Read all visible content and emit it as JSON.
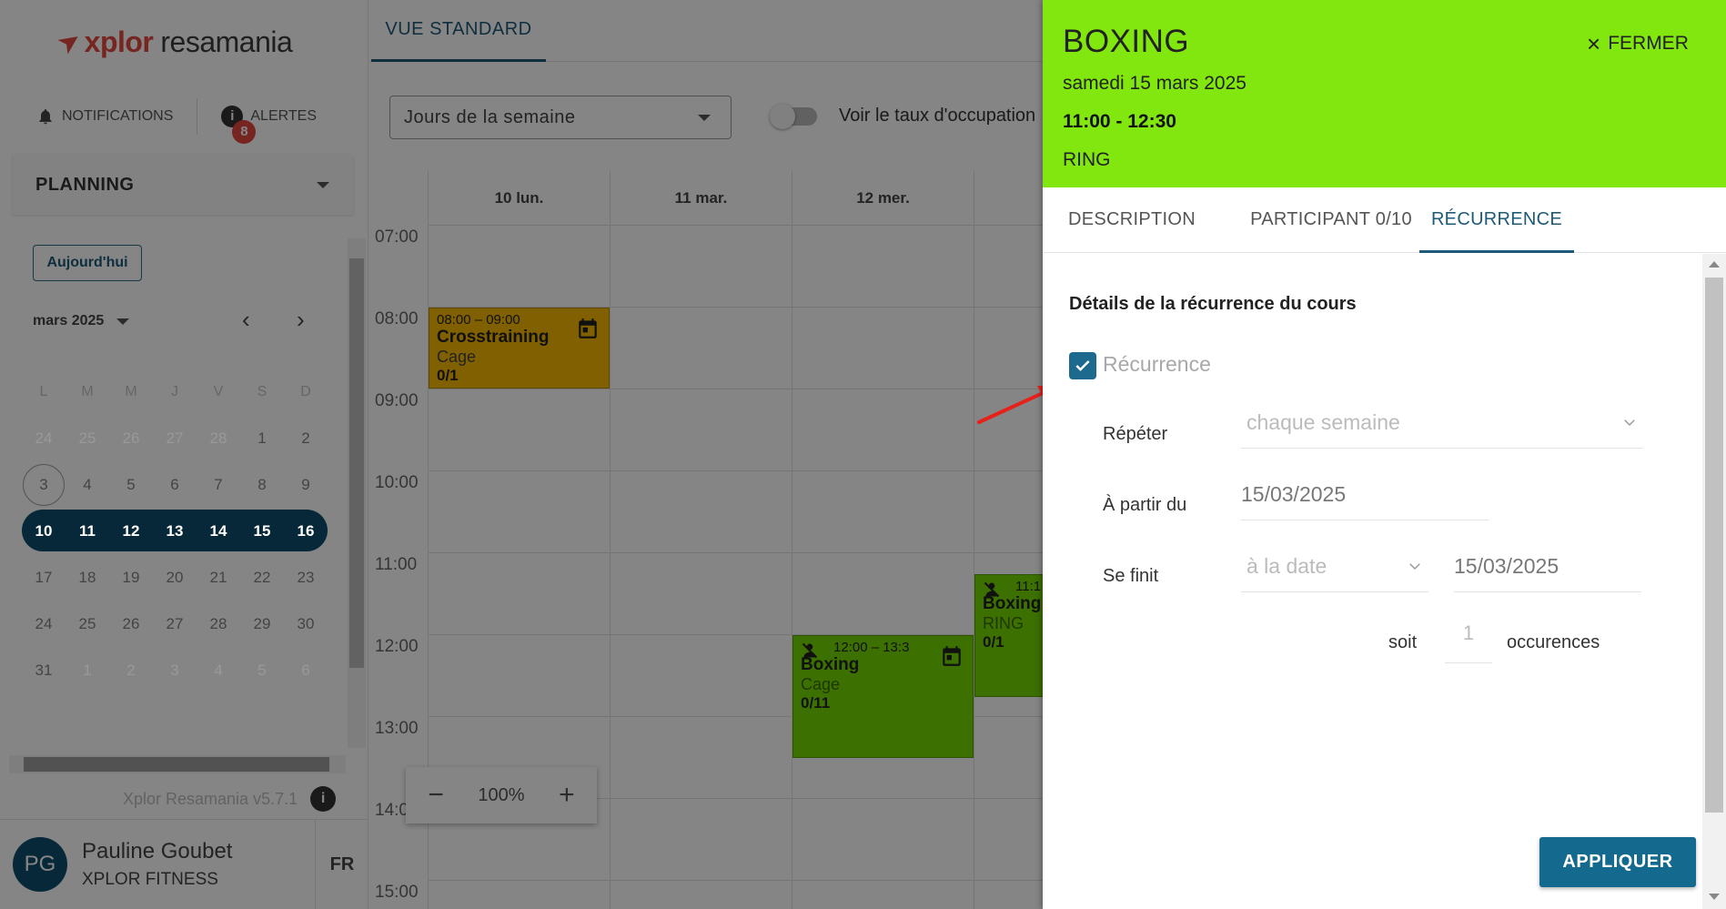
{
  "app": {
    "logo_part1": "xplor",
    "logo_part2": "resamania",
    "version": "Xplor Resamania v5.7.1"
  },
  "sidebar": {
    "notifications_label": "NOTIFICATIONS",
    "alerts_label": "ALERTES",
    "alerts_count": "8",
    "planning_label": "PLANNING",
    "today_button": "Aujourd'hui",
    "month_label": "mars 2025",
    "weekday_headers": [
      "L",
      "M",
      "M",
      "J",
      "V",
      "S",
      "D"
    ],
    "weeks": [
      [
        "24",
        "25",
        "26",
        "27",
        "28",
        "1",
        "2"
      ],
      [
        "3",
        "4",
        "5",
        "6",
        "7",
        "8",
        "9"
      ],
      [
        "10",
        "11",
        "12",
        "13",
        "14",
        "15",
        "16"
      ],
      [
        "17",
        "18",
        "19",
        "20",
        "21",
        "22",
        "23"
      ],
      [
        "24",
        "25",
        "26",
        "27",
        "28",
        "29",
        "30"
      ],
      [
        "31",
        "1",
        "2",
        "3",
        "4",
        "5",
        "6"
      ]
    ]
  },
  "user": {
    "initials": "PG",
    "name": "Pauline Goubet",
    "org": "XPLOR FITNESS",
    "language": "FR"
  },
  "main": {
    "tab_label": "VUE STANDARD",
    "filter_value": "Jours de la semaine",
    "toggle_label": "Voir le taux d'occupation",
    "days": [
      "10 lun.",
      "11 mar.",
      "12 mer."
    ],
    "hours": [
      "07:00",
      "08:00",
      "09:00",
      "10:00",
      "11:00",
      "12:00",
      "13:00",
      "14:00",
      "15:00"
    ],
    "zoom_level": "100%",
    "zoom_minus": "−",
    "zoom_plus": "+",
    "events": [
      {
        "time": "08:00 – 09:00",
        "name": "Crosstraining",
        "room": "Cage",
        "count": "0/1",
        "color": "#f5b800"
      },
      {
        "time": "12:00 – 13:3",
        "name": "Boxing",
        "room": "Cage",
        "count": "0/11",
        "color": "#74d600"
      },
      {
        "time": "11:1",
        "name": "Boxing",
        "room": "RING",
        "count": "0/1",
        "color": "#74d600"
      }
    ]
  },
  "panel": {
    "title": "BOXING",
    "date": "samedi 15 mars 2025",
    "time": "11:00 - 12:30",
    "room": "RING",
    "close_label": "FERMER",
    "header_color": "#82e60f",
    "tabs": [
      "DESCRIPTION",
      "PARTICIPANT 0/10",
      "RÉCURRENCE"
    ],
    "section_title": "Détails de la récurrence du cours",
    "recurrence_label": "Récurrence",
    "repeat_label": "Répéter",
    "repeat_value": "chaque semaine",
    "from_label": "À partir du",
    "from_value": "15/03/2025",
    "ends_label": "Se finit",
    "ends_mode": "à la date",
    "ends_date": "15/03/2025",
    "soit_label": "soit",
    "occurrences_value": "1",
    "occurrences_label": "occurences",
    "apply_button": "APPLIQUER"
  }
}
